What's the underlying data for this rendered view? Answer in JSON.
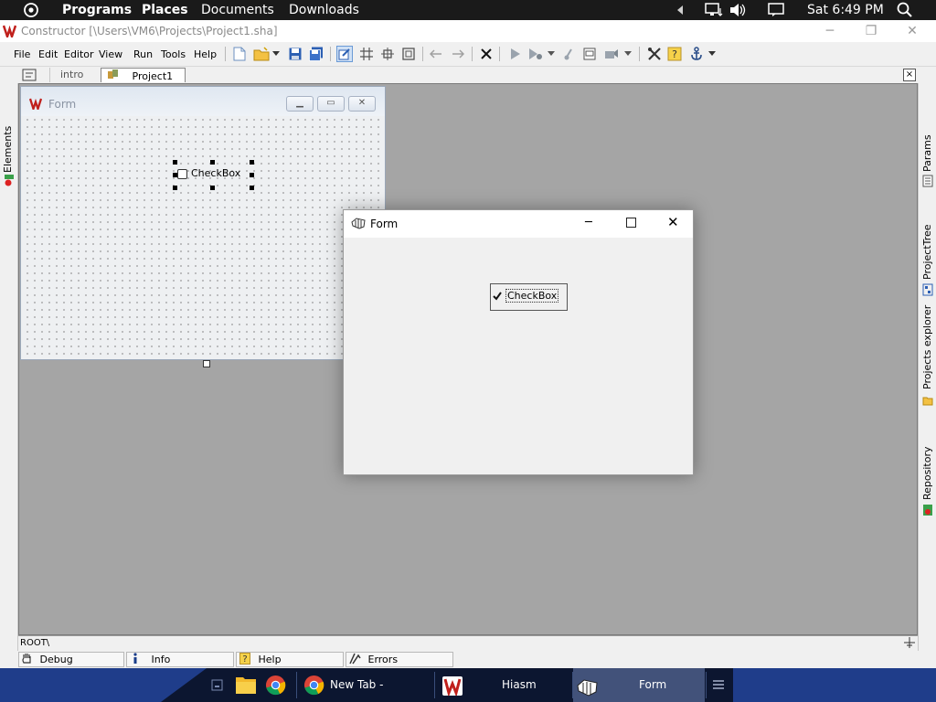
{
  "top_panel": {
    "apps_icon": "circle-dot-icon",
    "items": [
      "Programs",
      "Places",
      "Documents",
      "Downloads"
    ],
    "clock": "Sat 6:49 PM"
  },
  "window": {
    "title": "Constructor [\\Users\\VM6\\Projects\\Project1.sha]"
  },
  "menu": {
    "items": [
      "File",
      "Edit",
      "Editor",
      "View",
      "Run",
      "Tools",
      "Help"
    ]
  },
  "tabs": {
    "items": [
      "intro",
      "Project1"
    ],
    "active": "Project1"
  },
  "left_panel": {
    "label": "Elements"
  },
  "right_panel": {
    "tabs": [
      "Params",
      "ProjectTree",
      "Projects explorer",
      "Repository"
    ]
  },
  "design_form": {
    "title": "Form",
    "checkbox_label": "CheckBox",
    "checked": false
  },
  "run_form": {
    "title": "Form",
    "checkbox_label": "CheckBox",
    "checked": true
  },
  "status": {
    "path": "ROOT\\"
  },
  "bottom_tabs": {
    "items": [
      "Debug",
      "Info",
      "Help",
      "Errors"
    ]
  },
  "taskbar": {
    "items": [
      "New Tab - Google...",
      "Hiasm",
      "Form"
    ]
  },
  "colors": {
    "taskbar_blue": "#1f3d8a",
    "taskbar_dark": "#0c1630",
    "workspace_gray": "#a5a5a5",
    "top_panel": "#1a1a1a"
  }
}
